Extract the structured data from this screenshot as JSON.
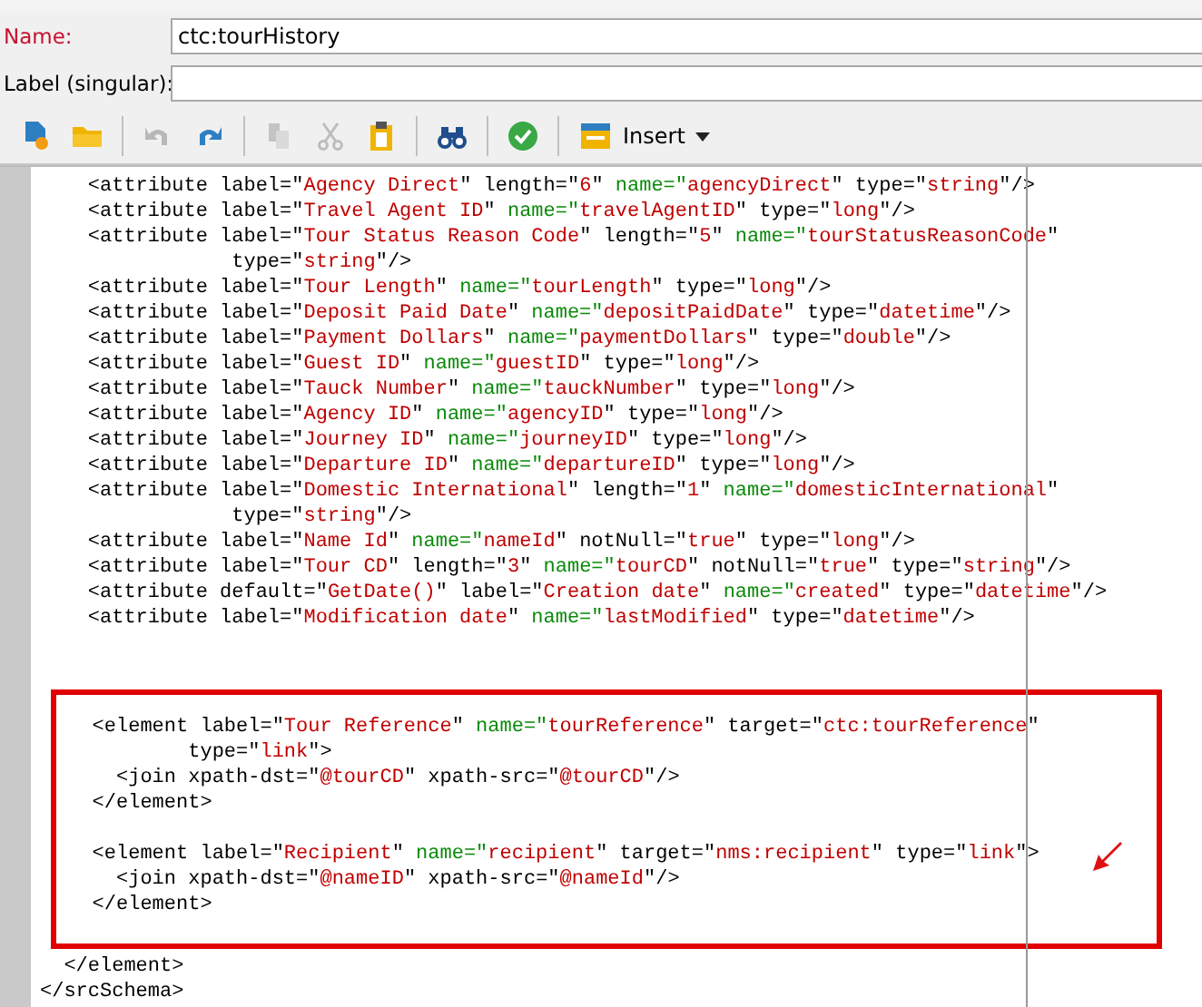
{
  "form": {
    "fields": [
      {
        "label": "Name:",
        "required": true,
        "value": "ctc:tourHistory"
      },
      {
        "label": "Label (singular):",
        "required": false
      }
    ]
  },
  "toolbar": [
    {
      "kind": "new",
      "disabled": false
    },
    {
      "kind": "open",
      "disabled": false
    },
    {
      "kind": "separator"
    },
    {
      "kind": "undo",
      "disabled": true
    },
    {
      "kind": "redo",
      "disabled": false
    },
    {
      "kind": "separator"
    },
    {
      "kind": "copy",
      "disabled": true
    },
    {
      "kind": "cut",
      "disabled": true
    },
    {
      "kind": "paste",
      "disabled": false
    },
    {
      "kind": "separator"
    },
    {
      "kind": "find",
      "disabled": false
    },
    {
      "kind": "separator"
    },
    {
      "kind": "check",
      "disabled": false
    },
    {
      "kind": "separator"
    },
    {
      "kind": "insert",
      "label": "Insert",
      "disabled": false
    }
  ],
  "editor": {
    "lines": [
      [
        {
          "kind": "markup",
          "text": "    <attribute label=\""
        },
        {
          "kind": "value",
          "text": "Agency Direct"
        },
        {
          "kind": "markup",
          "text": "\" length=\""
        },
        {
          "kind": "value",
          "text": "6"
        },
        {
          "kind": "markup",
          "text": "\" "
        },
        {
          "kind": "key",
          "text": "name=\""
        },
        {
          "kind": "value",
          "text": "agencyDirect"
        },
        {
          "kind": "markup",
          "text": "\" type=\""
        },
        {
          "kind": "value",
          "text": "string"
        },
        {
          "kind": "markup",
          "text": "\"/>"
        }
      ],
      [
        {
          "kind": "markup",
          "text": "    <attribute label=\""
        },
        {
          "kind": "value",
          "text": "Travel Agent ID"
        },
        {
          "kind": "markup",
          "text": "\" "
        },
        {
          "kind": "key",
          "text": "name=\""
        },
        {
          "kind": "value",
          "text": "travelAgentID"
        },
        {
          "kind": "markup",
          "text": "\" type=\""
        },
        {
          "kind": "value",
          "text": "long"
        },
        {
          "kind": "markup",
          "text": "\"/>"
        }
      ],
      [
        {
          "kind": "markup",
          "text": "    <attribute label=\""
        },
        {
          "kind": "value",
          "text": "Tour Status Reason Code"
        },
        {
          "kind": "markup",
          "text": "\" length=\""
        },
        {
          "kind": "value",
          "text": "5"
        },
        {
          "kind": "markup",
          "text": "\" "
        },
        {
          "kind": "key",
          "text": "name=\""
        },
        {
          "kind": "value",
          "text": "tourStatusReasonCode"
        },
        {
          "kind": "markup",
          "text": "\""
        }
      ],
      [
        {
          "kind": "markup",
          "text": "                type=\""
        },
        {
          "kind": "value",
          "text": "string"
        },
        {
          "kind": "markup",
          "text": "\"/>"
        }
      ],
      [
        {
          "kind": "markup",
          "text": "    <attribute label=\""
        },
        {
          "kind": "value",
          "text": "Tour Length"
        },
        {
          "kind": "markup",
          "text": "\" "
        },
        {
          "kind": "key",
          "text": "name=\""
        },
        {
          "kind": "value",
          "text": "tourLength"
        },
        {
          "kind": "markup",
          "text": "\" type=\""
        },
        {
          "kind": "value",
          "text": "long"
        },
        {
          "kind": "markup",
          "text": "\"/>"
        }
      ],
      [
        {
          "kind": "markup",
          "text": "    <attribute label=\""
        },
        {
          "kind": "value",
          "text": "Deposit Paid Date"
        },
        {
          "kind": "markup",
          "text": "\" "
        },
        {
          "kind": "key",
          "text": "name=\""
        },
        {
          "kind": "value",
          "text": "depositPaidDate"
        },
        {
          "kind": "markup",
          "text": "\" type=\""
        },
        {
          "kind": "value",
          "text": "datetime"
        },
        {
          "kind": "markup",
          "text": "\"/>"
        }
      ],
      [
        {
          "kind": "markup",
          "text": "    <attribute label=\""
        },
        {
          "kind": "value",
          "text": "Payment Dollars"
        },
        {
          "kind": "markup",
          "text": "\" "
        },
        {
          "kind": "key",
          "text": "name=\""
        },
        {
          "kind": "value",
          "text": "paymentDollars"
        },
        {
          "kind": "markup",
          "text": "\" type=\""
        },
        {
          "kind": "value",
          "text": "double"
        },
        {
          "kind": "markup",
          "text": "\"/>"
        }
      ],
      [
        {
          "kind": "markup",
          "text": "    <attribute label=\""
        },
        {
          "kind": "value",
          "text": "Guest ID"
        },
        {
          "kind": "markup",
          "text": "\" "
        },
        {
          "kind": "key",
          "text": "name=\""
        },
        {
          "kind": "value",
          "text": "guestID"
        },
        {
          "kind": "markup",
          "text": "\" type=\""
        },
        {
          "kind": "value",
          "text": "long"
        },
        {
          "kind": "markup",
          "text": "\"/>"
        }
      ],
      [
        {
          "kind": "markup",
          "text": "    <attribute label=\""
        },
        {
          "kind": "value",
          "text": "Tauck Number"
        },
        {
          "kind": "markup",
          "text": "\" "
        },
        {
          "kind": "key",
          "text": "name=\""
        },
        {
          "kind": "value",
          "text": "tauckNumber"
        },
        {
          "kind": "markup",
          "text": "\" type=\""
        },
        {
          "kind": "value",
          "text": "long"
        },
        {
          "kind": "markup",
          "text": "\"/>"
        }
      ],
      [
        {
          "kind": "markup",
          "text": "    <attribute label=\""
        },
        {
          "kind": "value",
          "text": "Agency ID"
        },
        {
          "kind": "markup",
          "text": "\" "
        },
        {
          "kind": "key",
          "text": "name=\""
        },
        {
          "kind": "value",
          "text": "agencyID"
        },
        {
          "kind": "markup",
          "text": "\" type=\""
        },
        {
          "kind": "value",
          "text": "long"
        },
        {
          "kind": "markup",
          "text": "\"/>"
        }
      ],
      [
        {
          "kind": "markup",
          "text": "    <attribute label=\""
        },
        {
          "kind": "value",
          "text": "Journey ID"
        },
        {
          "kind": "markup",
          "text": "\" "
        },
        {
          "kind": "key",
          "text": "name=\""
        },
        {
          "kind": "value",
          "text": "journeyID"
        },
        {
          "kind": "markup",
          "text": "\" type=\""
        },
        {
          "kind": "value",
          "text": "long"
        },
        {
          "kind": "markup",
          "text": "\"/>"
        }
      ],
      [
        {
          "kind": "markup",
          "text": "    <attribute label=\""
        },
        {
          "kind": "value",
          "text": "Departure ID"
        },
        {
          "kind": "markup",
          "text": "\" "
        },
        {
          "kind": "key",
          "text": "name=\""
        },
        {
          "kind": "value",
          "text": "departureID"
        },
        {
          "kind": "markup",
          "text": "\" type=\""
        },
        {
          "kind": "value",
          "text": "long"
        },
        {
          "kind": "markup",
          "text": "\"/>"
        }
      ],
      [
        {
          "kind": "markup",
          "text": "    <attribute label=\""
        },
        {
          "kind": "value",
          "text": "Domestic International"
        },
        {
          "kind": "markup",
          "text": "\" length=\""
        },
        {
          "kind": "value",
          "text": "1"
        },
        {
          "kind": "markup",
          "text": "\" "
        },
        {
          "kind": "key",
          "text": "name=\""
        },
        {
          "kind": "value",
          "text": "domesticInternational"
        },
        {
          "kind": "markup",
          "text": "\""
        }
      ],
      [
        {
          "kind": "markup",
          "text": "                type=\""
        },
        {
          "kind": "value",
          "text": "string"
        },
        {
          "kind": "markup",
          "text": "\"/>"
        }
      ],
      [
        {
          "kind": "markup",
          "text": "    <attribute label=\""
        },
        {
          "kind": "value",
          "text": "Name Id"
        },
        {
          "kind": "markup",
          "text": "\" "
        },
        {
          "kind": "key",
          "text": "name=\""
        },
        {
          "kind": "value",
          "text": "nameId"
        },
        {
          "kind": "markup",
          "text": "\" notNull=\""
        },
        {
          "kind": "value",
          "text": "true"
        },
        {
          "kind": "markup",
          "text": "\" type=\""
        },
        {
          "kind": "value",
          "text": "long"
        },
        {
          "kind": "markup",
          "text": "\"/>"
        }
      ],
      [
        {
          "kind": "markup",
          "text": "    <attribute label=\""
        },
        {
          "kind": "value",
          "text": "Tour CD"
        },
        {
          "kind": "markup",
          "text": "\" length=\""
        },
        {
          "kind": "value",
          "text": "3"
        },
        {
          "kind": "markup",
          "text": "\" "
        },
        {
          "kind": "key",
          "text": "name=\""
        },
        {
          "kind": "value",
          "text": "tourCD"
        },
        {
          "kind": "markup",
          "text": "\" notNull=\""
        },
        {
          "kind": "value",
          "text": "true"
        },
        {
          "kind": "markup",
          "text": "\" type=\""
        },
        {
          "kind": "value",
          "text": "string"
        },
        {
          "kind": "markup",
          "text": "\"/>"
        }
      ],
      [
        {
          "kind": "markup",
          "text": "    <attribute default=\""
        },
        {
          "kind": "value",
          "text": "GetDate()"
        },
        {
          "kind": "markup",
          "text": "\" label=\""
        },
        {
          "kind": "value",
          "text": "Creation date"
        },
        {
          "kind": "markup",
          "text": "\" "
        },
        {
          "kind": "key",
          "text": "name=\""
        },
        {
          "kind": "value",
          "text": "created"
        },
        {
          "kind": "markup",
          "text": "\" type=\""
        },
        {
          "kind": "value",
          "text": "datetime"
        },
        {
          "kind": "markup",
          "text": "\"/>"
        }
      ],
      [
        {
          "kind": "markup",
          "text": "    <attribute label=\""
        },
        {
          "kind": "value",
          "text": "Modification date"
        },
        {
          "kind": "markup",
          "text": "\" "
        },
        {
          "kind": "key",
          "text": "name=\""
        },
        {
          "kind": "value",
          "text": "lastModified"
        },
        {
          "kind": "markup",
          "text": "\" type=\""
        },
        {
          "kind": "value",
          "text": "datetime"
        },
        {
          "kind": "markup",
          "text": "\"/>"
        }
      ]
    ],
    "highlight": {
      "blocks": [
        [
          [
            {
              "kind": "markup",
              "text": "   <element label=\""
            },
            {
              "kind": "value",
              "text": "Tour Reference"
            },
            {
              "kind": "markup",
              "text": "\" "
            },
            {
              "kind": "key",
              "text": "name=\""
            },
            {
              "kind": "value",
              "text": "tourReference"
            },
            {
              "kind": "markup",
              "text": "\" target=\""
            },
            {
              "kind": "value",
              "text": "ctc:tourReference"
            },
            {
              "kind": "markup",
              "text": "\""
            }
          ],
          [
            {
              "kind": "markup",
              "text": "           type=\""
            },
            {
              "kind": "value",
              "text": "link"
            },
            {
              "kind": "markup",
              "text": "\">"
            }
          ],
          [
            {
              "kind": "markup",
              "text": "     <join xpath-dst=\""
            },
            {
              "kind": "value",
              "text": "@tourCD"
            },
            {
              "kind": "markup",
              "text": "\" xpath-src=\""
            },
            {
              "kind": "value",
              "text": "@tourCD"
            },
            {
              "kind": "markup",
              "text": "\"/>"
            }
          ],
          [
            {
              "kind": "markup",
              "text": "   </element>"
            }
          ]
        ],
        [
          [
            {
              "kind": "markup",
              "text": "   <element label=\""
            },
            {
              "kind": "value",
              "text": "Recipient"
            },
            {
              "kind": "markup",
              "text": "\" "
            },
            {
              "kind": "key",
              "text": "name=\""
            },
            {
              "kind": "value",
              "text": "recipient"
            },
            {
              "kind": "markup",
              "text": "\" target=\""
            },
            {
              "kind": "value",
              "text": "nms:recipient"
            },
            {
              "kind": "markup",
              "text": "\" type=\""
            },
            {
              "kind": "value",
              "text": "link"
            },
            {
              "kind": "markup",
              "text": "\">"
            }
          ],
          [
            {
              "kind": "markup",
              "text": "     <join xpath-dst=\""
            },
            {
              "kind": "value",
              "text": "@nameID"
            },
            {
              "kind": "markup",
              "text": "\" xpath-src=\""
            },
            {
              "kind": "value",
              "text": "@nameId"
            },
            {
              "kind": "markup",
              "text": "\"/>"
            }
          ],
          [
            {
              "kind": "markup",
              "text": "   </element>"
            }
          ]
        ]
      ]
    },
    "closing_lines": [
      [
        {
          "kind": "markup",
          "text": "  </element>"
        }
      ],
      [
        {
          "kind": "markup",
          "text": "</srcSchema>"
        }
      ]
    ]
  }
}
